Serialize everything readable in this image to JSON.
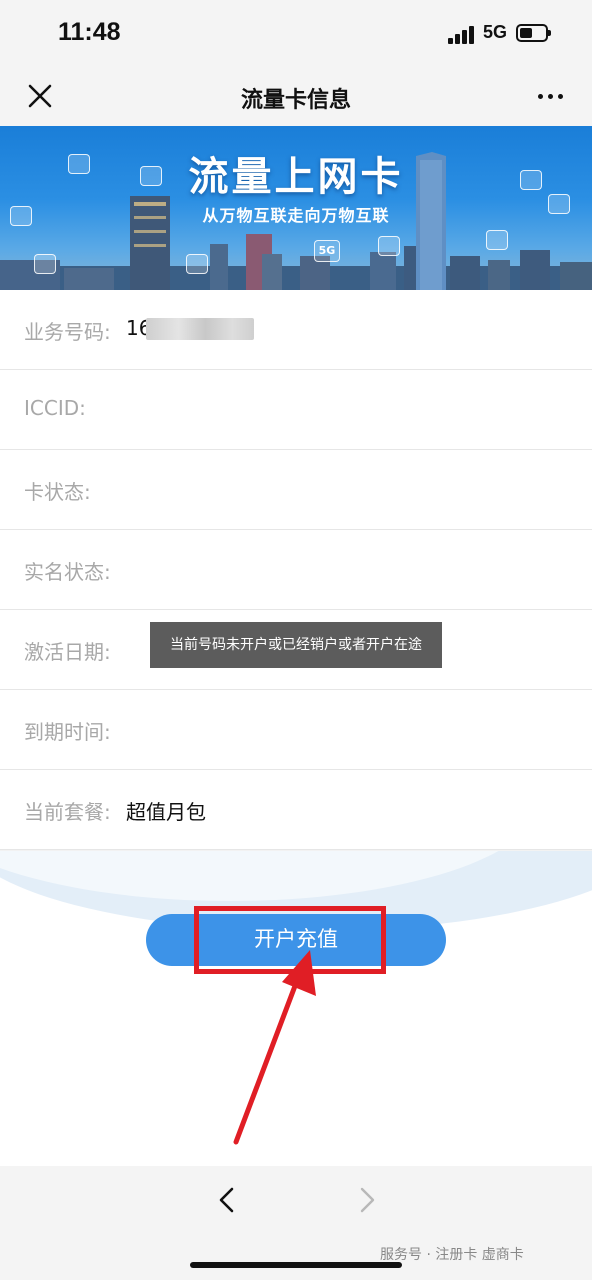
{
  "status_bar": {
    "time": "11:48",
    "network": "5G"
  },
  "nav": {
    "title": "流量卡信息",
    "close_icon": "close-icon",
    "more_icon": "more-icon"
  },
  "banner": {
    "title": "流量上网卡",
    "subtitle": "从万物互联走向万物互联",
    "badge_5g": "5G"
  },
  "info": {
    "rows": [
      {
        "label": "业务号码:",
        "value": "16"
      },
      {
        "label": "ICCID:",
        "value": ""
      },
      {
        "label": "卡状态:",
        "value": ""
      },
      {
        "label": "实名状态:",
        "value": ""
      },
      {
        "label": "激活日期:",
        "value": ""
      },
      {
        "label": "到期时间:",
        "value": ""
      },
      {
        "label": "当前套餐:",
        "value": "超值月包"
      }
    ]
  },
  "toast": "当前号码未开户或已经销户或者开户在途",
  "actions": {
    "open_button": "开户充值"
  },
  "bottom": {
    "back_icon": "chevron-left-icon",
    "forward_icon": "chevron-right-icon",
    "watermark": "服务号 · 注册卡 虚商卡"
  },
  "colors": {
    "accent": "#3d93e8",
    "highlight": "#e01e25",
    "toast_bg": "#5c5c5c"
  }
}
